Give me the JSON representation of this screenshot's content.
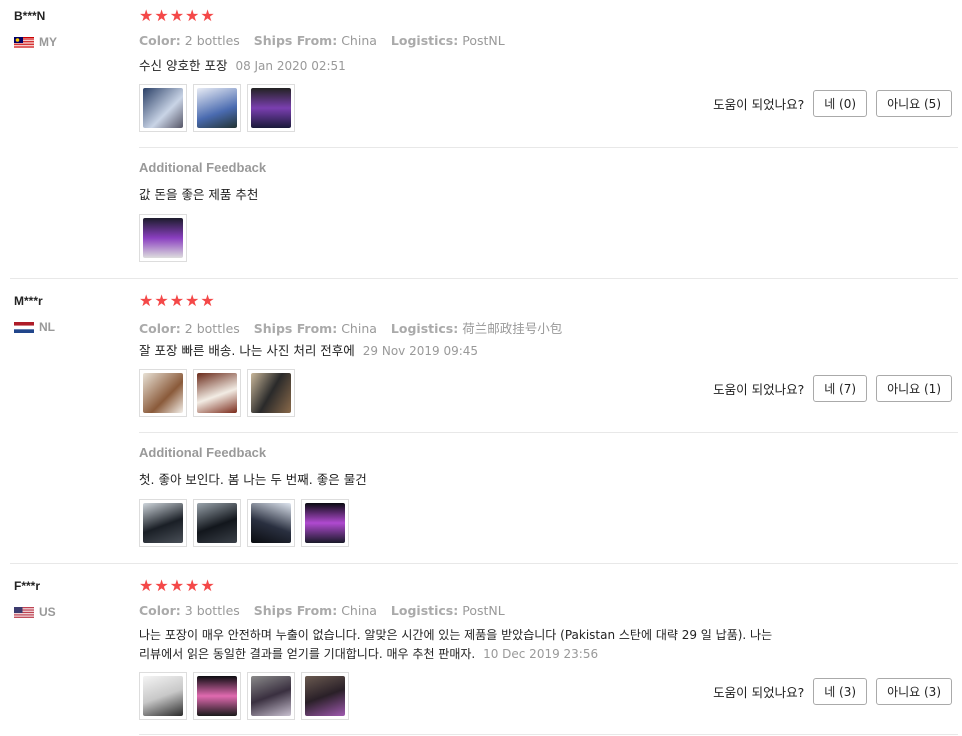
{
  "helpful_question": "도움이 되었나요?",
  "labels": {
    "color": "Color:",
    "ships_from": "Ships From:",
    "logistics": "Logistics:",
    "additional_feedback": "Additional Feedback"
  },
  "reviews": [
    {
      "user": "B***N",
      "country": "MY",
      "stars": "★★★★★",
      "color": "2 bottles",
      "ships_from": "China",
      "logistics": "PostNL",
      "text": "수신 양호한 포장",
      "date": "08 Jan 2020 02:51",
      "yes": "네 (0)",
      "no": "아니요 (5)",
      "additional_text": "값 돈을 좋은 제품 추천"
    },
    {
      "user": "M***r",
      "country": "NL",
      "stars": "★★★★★",
      "color": "2 bottles",
      "ships_from": "China",
      "logistics": "荷兰邮政挂号小包",
      "text": "잘 포장 빠른 배송. 나는 사진 처리 전후에",
      "date": "29 Nov 2019 09:45",
      "yes": "네 (7)",
      "no": "아니요 (1)",
      "additional_text": "첫. 좋아 보인다. 봄 나는 두 번째. 좋은 물건"
    },
    {
      "user": "F***r",
      "country": "US",
      "stars": "★★★★★",
      "color": "3 bottles",
      "ships_from": "China",
      "logistics": "PostNL",
      "text_line1": "나는 포장이 매우 안전하며 누출이 없습니다. 알맞은 시간에 있는 제품을 받았습니다 (Pakistan 스탄에 대략 29 일 납품). 나는",
      "text_line2": "리뷰에서 읽은 동일한 결과를 얻기를 기대합니다. 매우 추천 판매자.",
      "date": "10 Dec 2019 23:56",
      "yes": "네 (3)",
      "no": "아니요 (3)"
    }
  ],
  "colors": {
    "star": "#f44848",
    "muted": "#999999",
    "divider": "#e8e8e8"
  }
}
